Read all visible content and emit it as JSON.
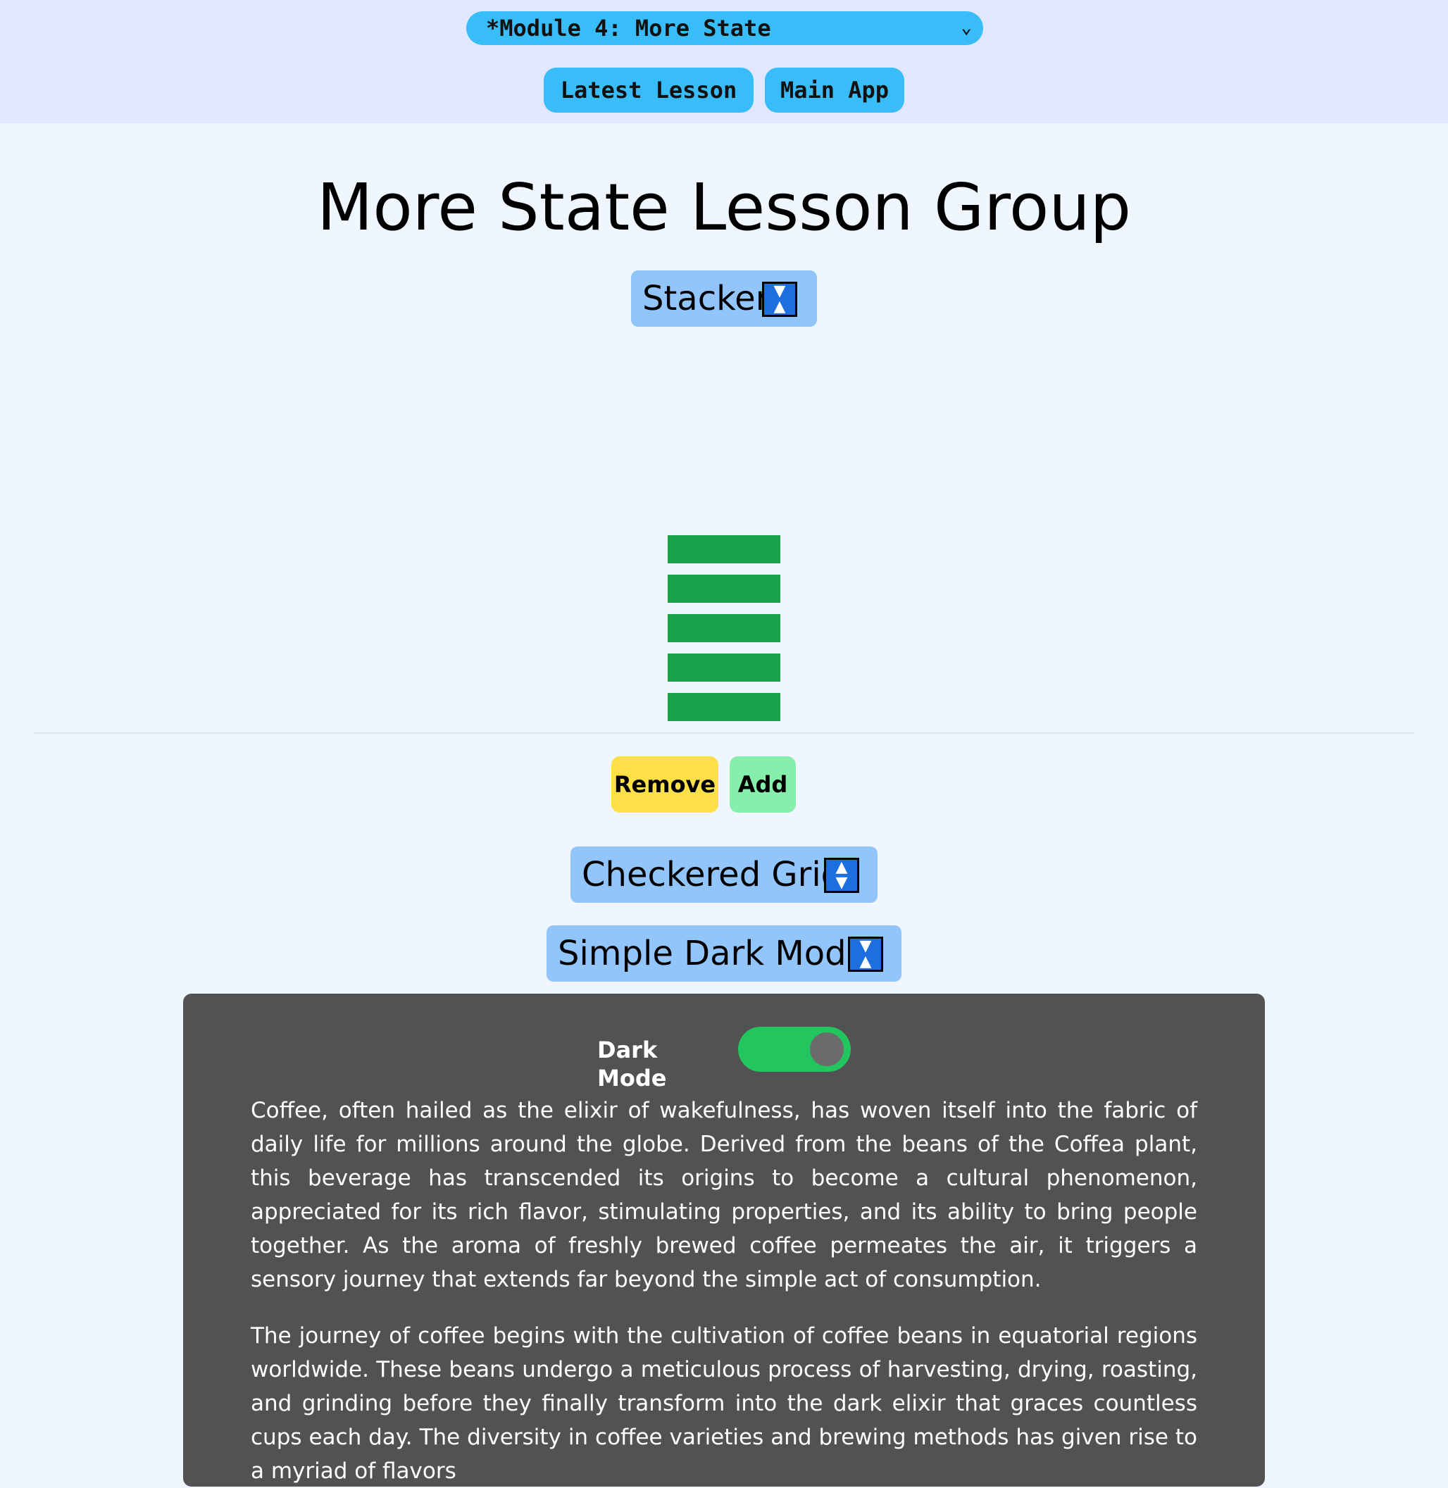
{
  "header": {
    "module_select": "*Module 4: More State",
    "latest_lesson": "Latest Lesson",
    "main_app": "Main App"
  },
  "page_title": "More State Lesson Group",
  "sections": {
    "stacker": "Stacker",
    "checkered_grid": "Checkered Grid",
    "simple_dark_mode": "Simple Dark Mode"
  },
  "stacker": {
    "block_count": 5,
    "block_color": "#16a34a",
    "remove_label": "Remove",
    "add_label": "Add"
  },
  "dark_mode": {
    "label": "Dark Mode",
    "enabled": true,
    "paragraphs": [
      "Coffee, often hailed as the elixir of wakefulness, has woven itself into the fabric of daily life for millions around the globe. Derived from the beans of the Coffea plant, this beverage has transcended its origins to become a cultural phenomenon, appreciated for its rich flavor, stimulating properties, and its ability to bring people together. As the aroma of freshly brewed coffee permeates the air, it triggers a sensory journey that extends far beyond the simple act of consumption.",
      "The journey of coffee begins with the cultivation of coffee beans in equatorial regions worldwide. These beans undergo a meticulous process of harvesting, drying, roasting, and grinding before they finally transform into the dark elixir that graces countless cups each day. The diversity in coffee varieties and brewing methods has given rise to a myriad of flavors"
    ]
  },
  "colors": {
    "header_bg": "#e0e7ff",
    "page_bg": "#eff6ff",
    "nav_button": "#38bdf8",
    "section_header": "#93c5fd",
    "remove_button": "#fde047",
    "add_button": "#86efac",
    "dark_panel": "#525252",
    "toggle_on": "#22c55e"
  }
}
